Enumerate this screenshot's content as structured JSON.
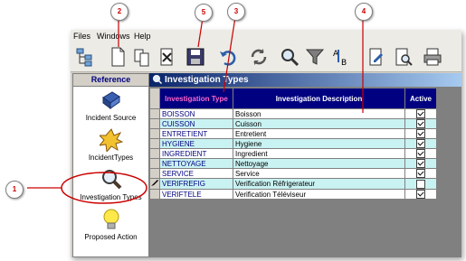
{
  "menu": [
    "Files",
    "Windows",
    "Help"
  ],
  "sidebar": {
    "header": "Reference",
    "items": [
      {
        "label": "Incident Source",
        "icon": "incident-source-icon"
      },
      {
        "label": "IncidentTypes",
        "icon": "incident-types-icon"
      },
      {
        "label": "Investigation Types",
        "icon": "magnifier-icon"
      },
      {
        "label": "Proposed Action",
        "icon": "lightbulb-icon"
      }
    ]
  },
  "document": {
    "title": "Investigation Types",
    "columns": [
      "Investigation Type",
      "Investigation Description",
      "Active"
    ],
    "rows": [
      {
        "code": "BOISSON",
        "desc": "Boisson",
        "active": true
      },
      {
        "code": "CUISSON",
        "desc": "Cuisson",
        "active": true
      },
      {
        "code": "ENTRETIENT",
        "desc": "Entretient",
        "active": true
      },
      {
        "code": "HYGIENE",
        "desc": "Hygiene",
        "active": true
      },
      {
        "code": "INGREDIENT",
        "desc": "Ingredient",
        "active": true
      },
      {
        "code": "NETTOYAGE",
        "desc": "Nettoyage",
        "active": true
      },
      {
        "code": "SERVICE",
        "desc": "Service",
        "active": true
      },
      {
        "code": "VERIFREFIG",
        "desc": "Verification Réfrigerateur",
        "active": false
      },
      {
        "code": "VERIFTELE",
        "desc": "Verification Téléviseur",
        "active": true
      }
    ]
  },
  "callouts": [
    "1",
    "2",
    "3",
    "4",
    "5"
  ],
  "colors": {
    "header_bg": "#000080",
    "row_alt": "#c9f2f2",
    "callout_ring": "#cc0000"
  }
}
